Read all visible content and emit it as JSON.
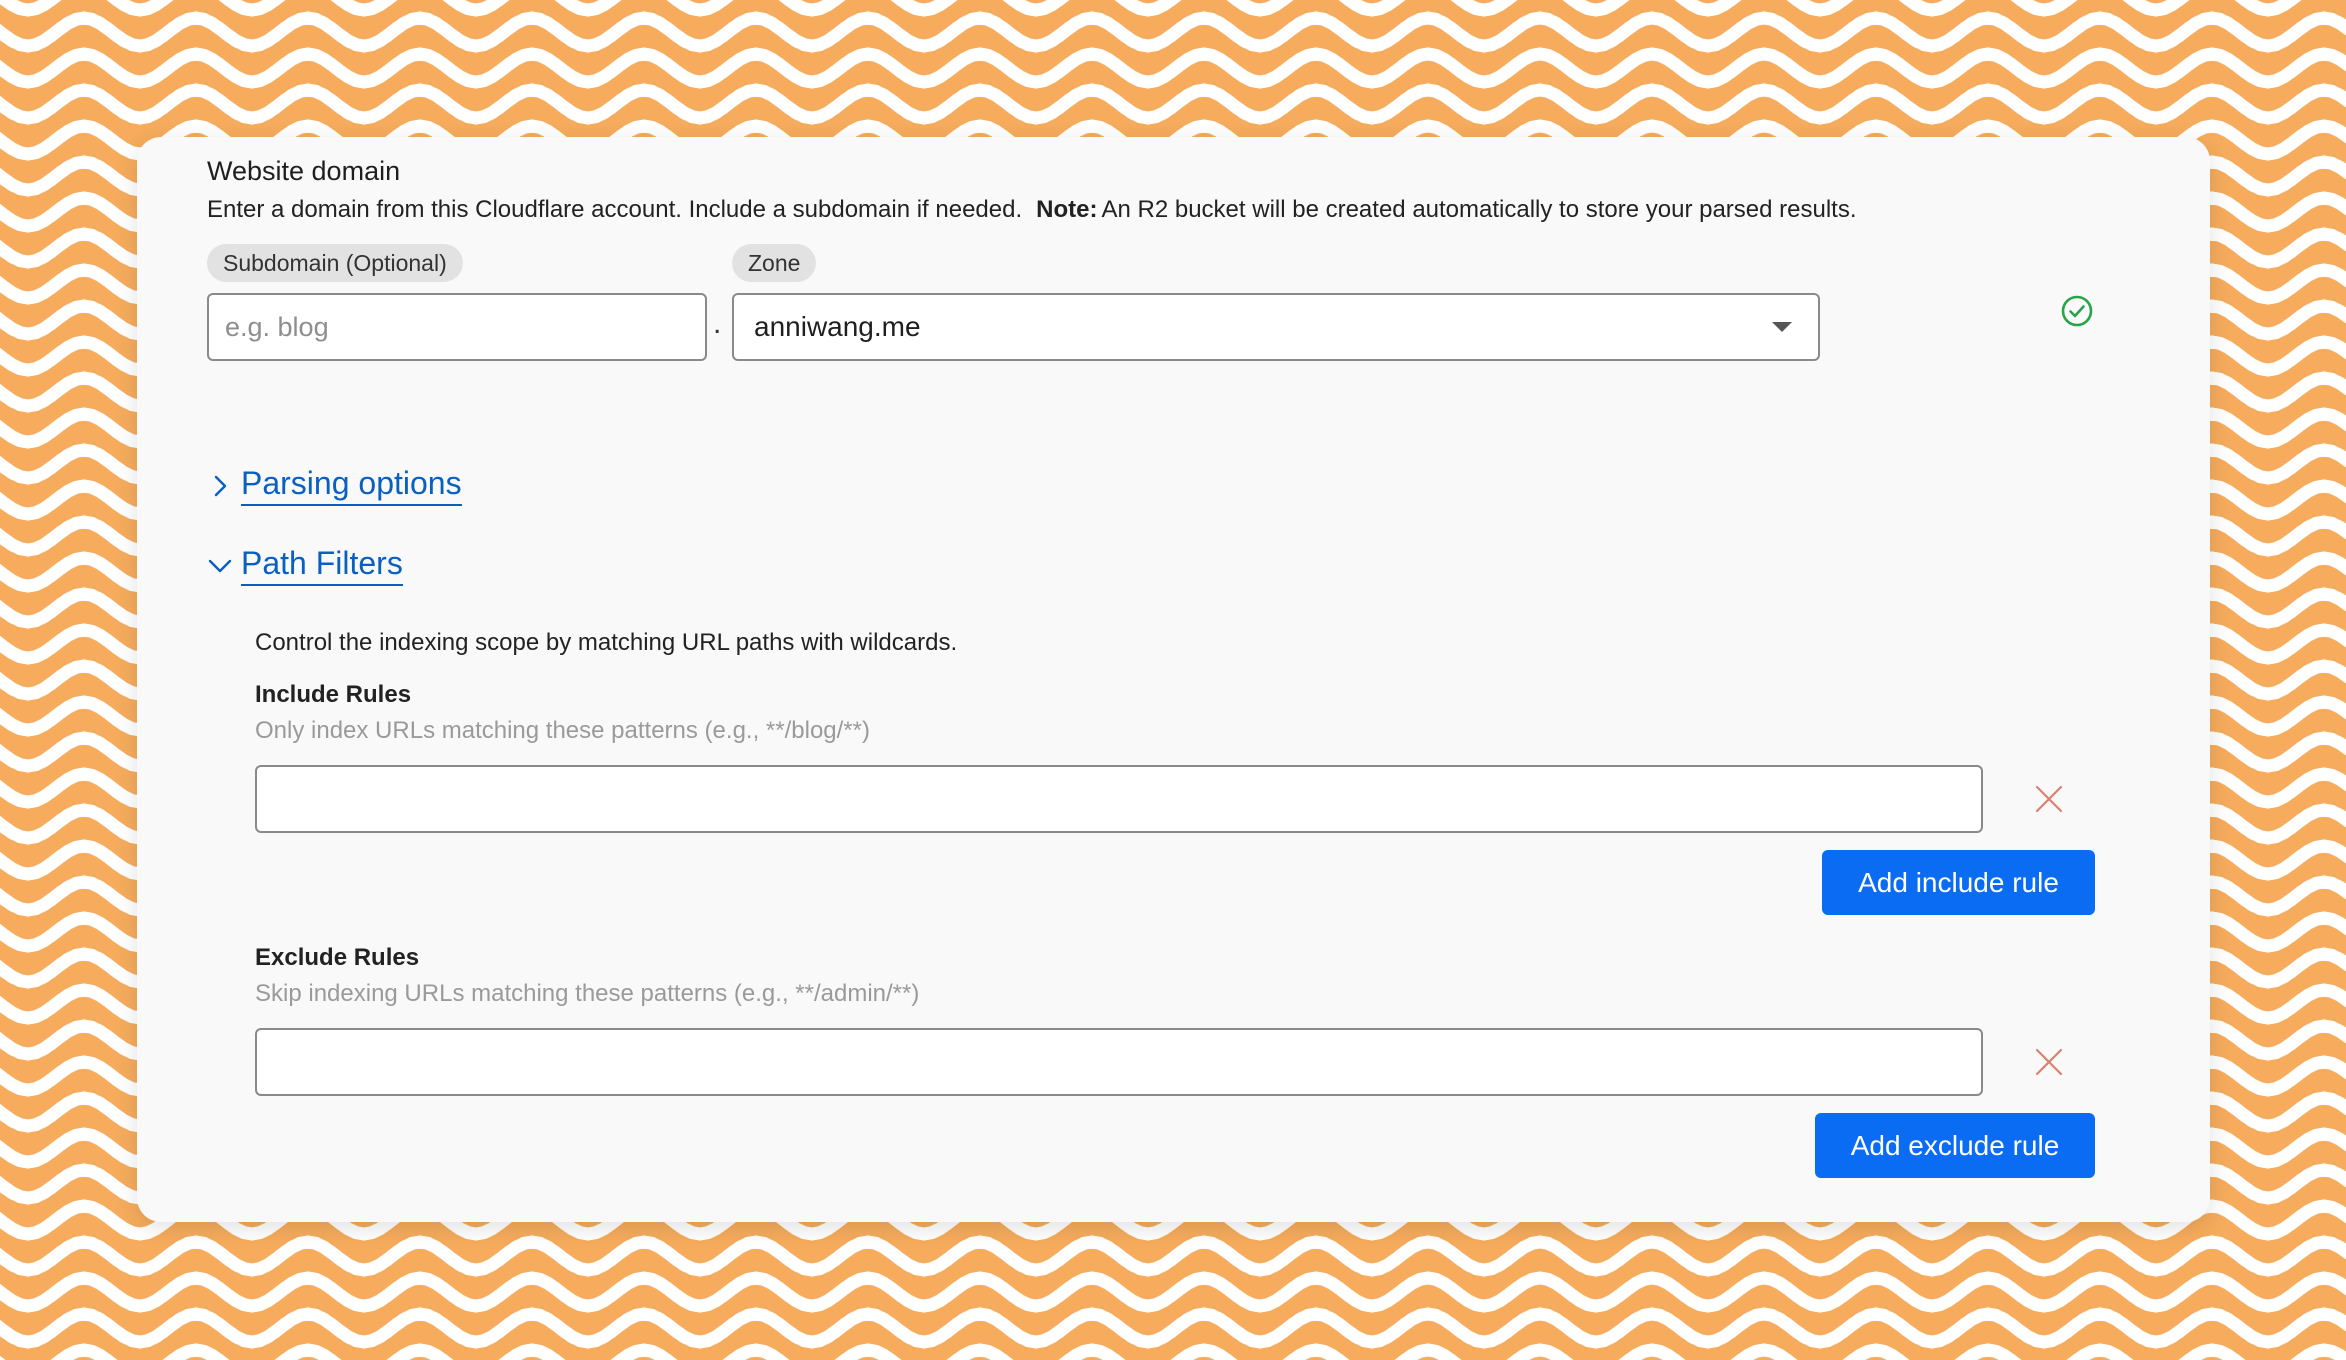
{
  "colors": {
    "background_orange": "#f6ac5c",
    "wave_white": "#ffffff",
    "card": "#f9f9f9",
    "link_blue": "#0a5fc2",
    "button_blue": "#0a6cf2",
    "success_green": "#27a34a",
    "remove_red": "#d9826f"
  },
  "website_domain": {
    "title": "Website domain",
    "description": "Enter a domain from this Cloudflare account. Include a subdomain if needed.",
    "note_label": "Note:",
    "note_text": "An R2 bucket will be created automatically to store your parsed results.",
    "subdomain": {
      "label": "Subdomain (Optional)",
      "placeholder": "e.g. blog",
      "value": ""
    },
    "separator": ".",
    "zone": {
      "label": "Zone",
      "selected": "anniwang.me"
    },
    "status_icon": "check-circle-icon"
  },
  "sections": {
    "parsing_options": {
      "label": "Parsing options",
      "expanded": false
    },
    "path_filters": {
      "label": "Path Filters",
      "expanded": true
    }
  },
  "path_filters": {
    "description": "Control the indexing scope by matching URL paths with wildcards.",
    "include": {
      "title": "Include Rules",
      "hint": "Only index URLs matching these patterns (e.g., **/blog/**)",
      "value": "",
      "add_label": "Add include rule"
    },
    "exclude": {
      "title": "Exclude Rules",
      "hint": "Skip indexing URLs matching these patterns (e.g., **/admin/**)",
      "value": "",
      "add_label": "Add exclude rule"
    }
  }
}
